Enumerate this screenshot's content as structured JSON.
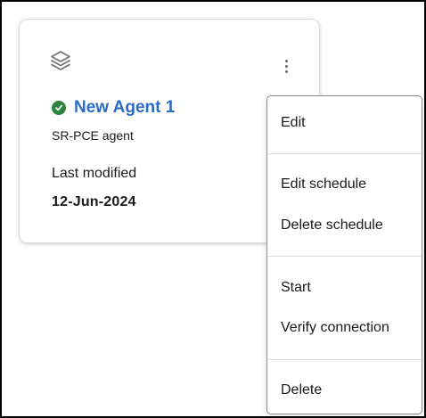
{
  "card": {
    "icon": "layers-icon",
    "menu_icon": "kebab-menu-icon",
    "status": {
      "icon": "check-circle-icon",
      "color": "#2e8540"
    },
    "agent_name": "New Agent 1",
    "agent_name_color": "#2a6cc7",
    "agent_type": "SR-PCE agent",
    "last_modified_label": "Last modified",
    "last_modified_value": "12-Jun-2024"
  },
  "menu": {
    "items": [
      {
        "label": "Edit"
      },
      {
        "label": "Edit schedule"
      },
      {
        "label": "Delete schedule"
      },
      {
        "label": "Start"
      },
      {
        "label": "Verify connection"
      },
      {
        "label": "Delete"
      }
    ]
  }
}
